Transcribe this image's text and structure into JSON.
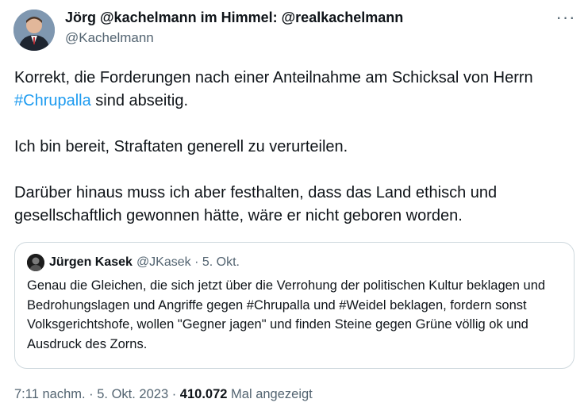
{
  "author": {
    "name": "Jörg @kachelmann im Himmel: @realkachelmann",
    "handle": "@Kachelmann"
  },
  "more_glyph": "···",
  "tweet": {
    "p1_before": "Korrekt, die Forderungen nach einer Anteilnahme am Schicksal von Herrn ",
    "p1_hashtag": "#Chrupalla",
    "p1_after": " sind abseitig.",
    "p2": "Ich bin bereit, Straftaten generell zu verurteilen.",
    "p3": "Darüber hinaus muss ich aber festhalten, dass das Land ethisch und gesellschaftlich gewonnen hätte, wäre er nicht geboren worden."
  },
  "quote": {
    "name": "Jürgen Kasek",
    "handle_date": "@JKasek · 5. Okt.",
    "text": "Genau die Gleichen, die sich jetzt über die Verrohung der politischen Kultur beklagen und Bedrohungslagen und Angriffe gegen #Chrupalla und #Weidel beklagen, fordern sonst Volksgerichtshofe, wollen \"Gegner jagen\" und finden Steine gegen Grüne völlig ok und Ausdruck des Zorns."
  },
  "meta": {
    "time_date": "7:11 nachm. · 5. Okt. 2023 · ",
    "views": "410.072",
    "views_label": " Mal angezeigt"
  },
  "colors": {
    "text": "#0f1419",
    "secondary": "#536471",
    "link": "#1d9bf0",
    "border": "#cfd9de"
  }
}
